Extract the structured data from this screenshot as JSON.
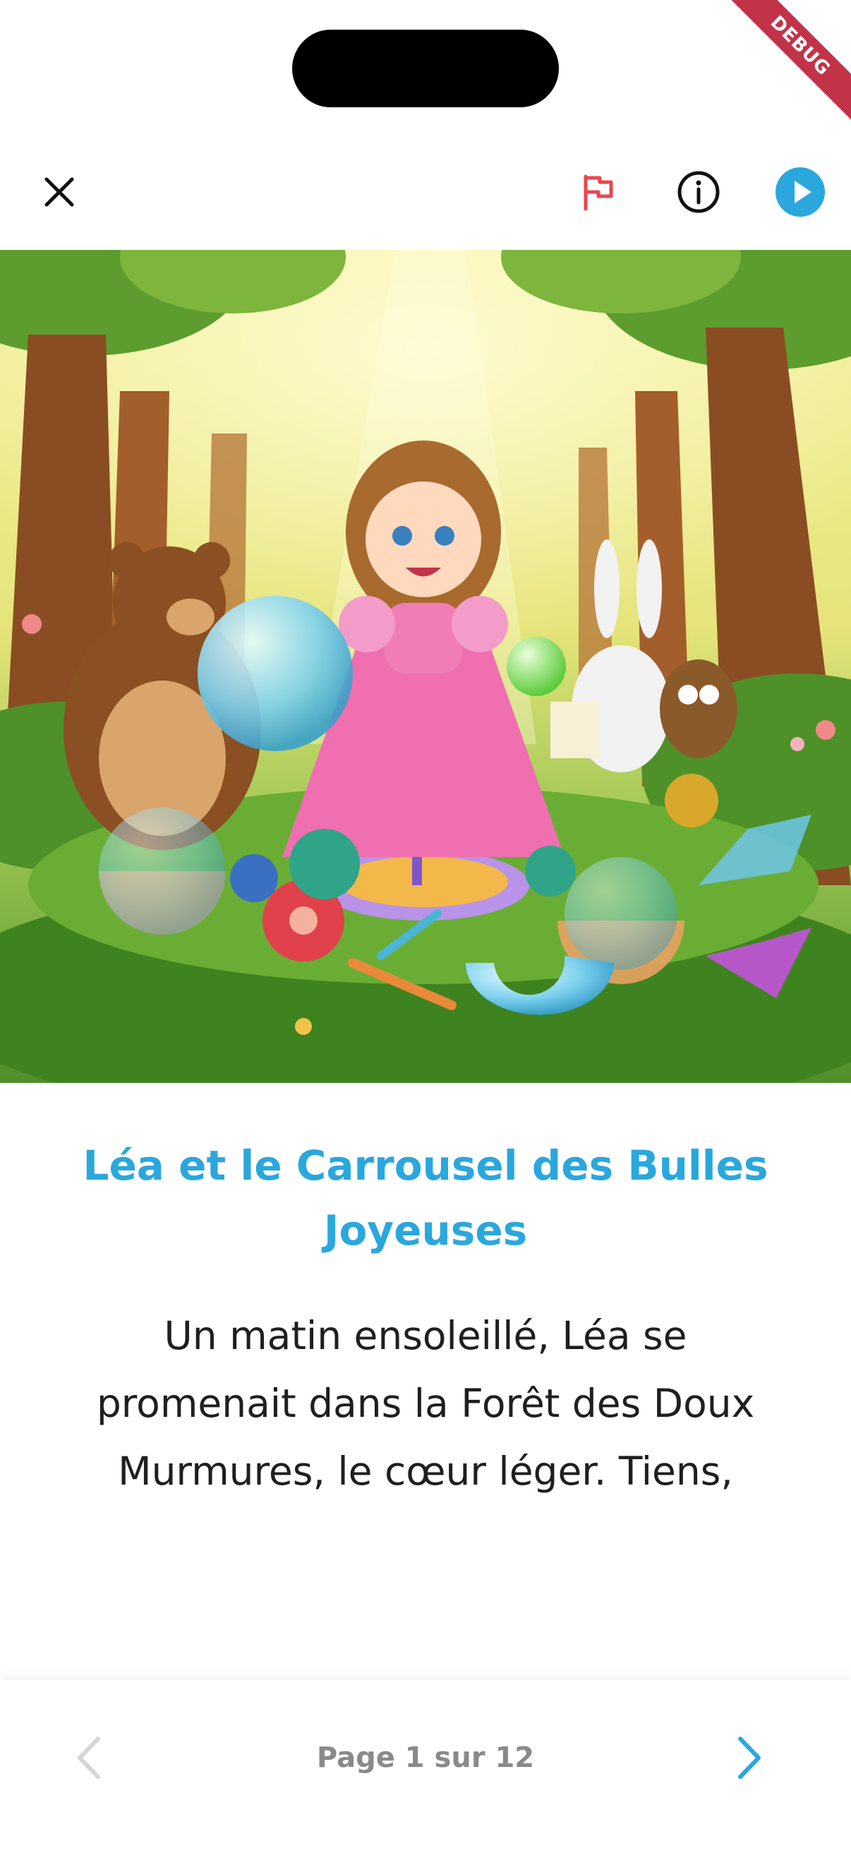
{
  "system": {
    "debug_banner": "DEBUG"
  },
  "toolbar": {
    "close_icon": "close-icon",
    "flag_icon": "flag-icon",
    "info_icon": "info-icon",
    "play_icon": "play-icon",
    "flag_color": "#e8464e",
    "play_color": "#2aa7dd"
  },
  "story": {
    "title": "Léa et le Carrousel des Bulles Joyeuses",
    "text": "Un matin ensoleillé, Léa se promenait dans la Forêt des Doux Murmures, le cœur léger. Tiens,",
    "accent_color": "#2aa7dd"
  },
  "pagination": {
    "label": "Page 1 sur 12",
    "current_page": 1,
    "total_pages": 12,
    "prev_icon": "chevron-left-icon",
    "next_icon": "chevron-right-icon"
  }
}
